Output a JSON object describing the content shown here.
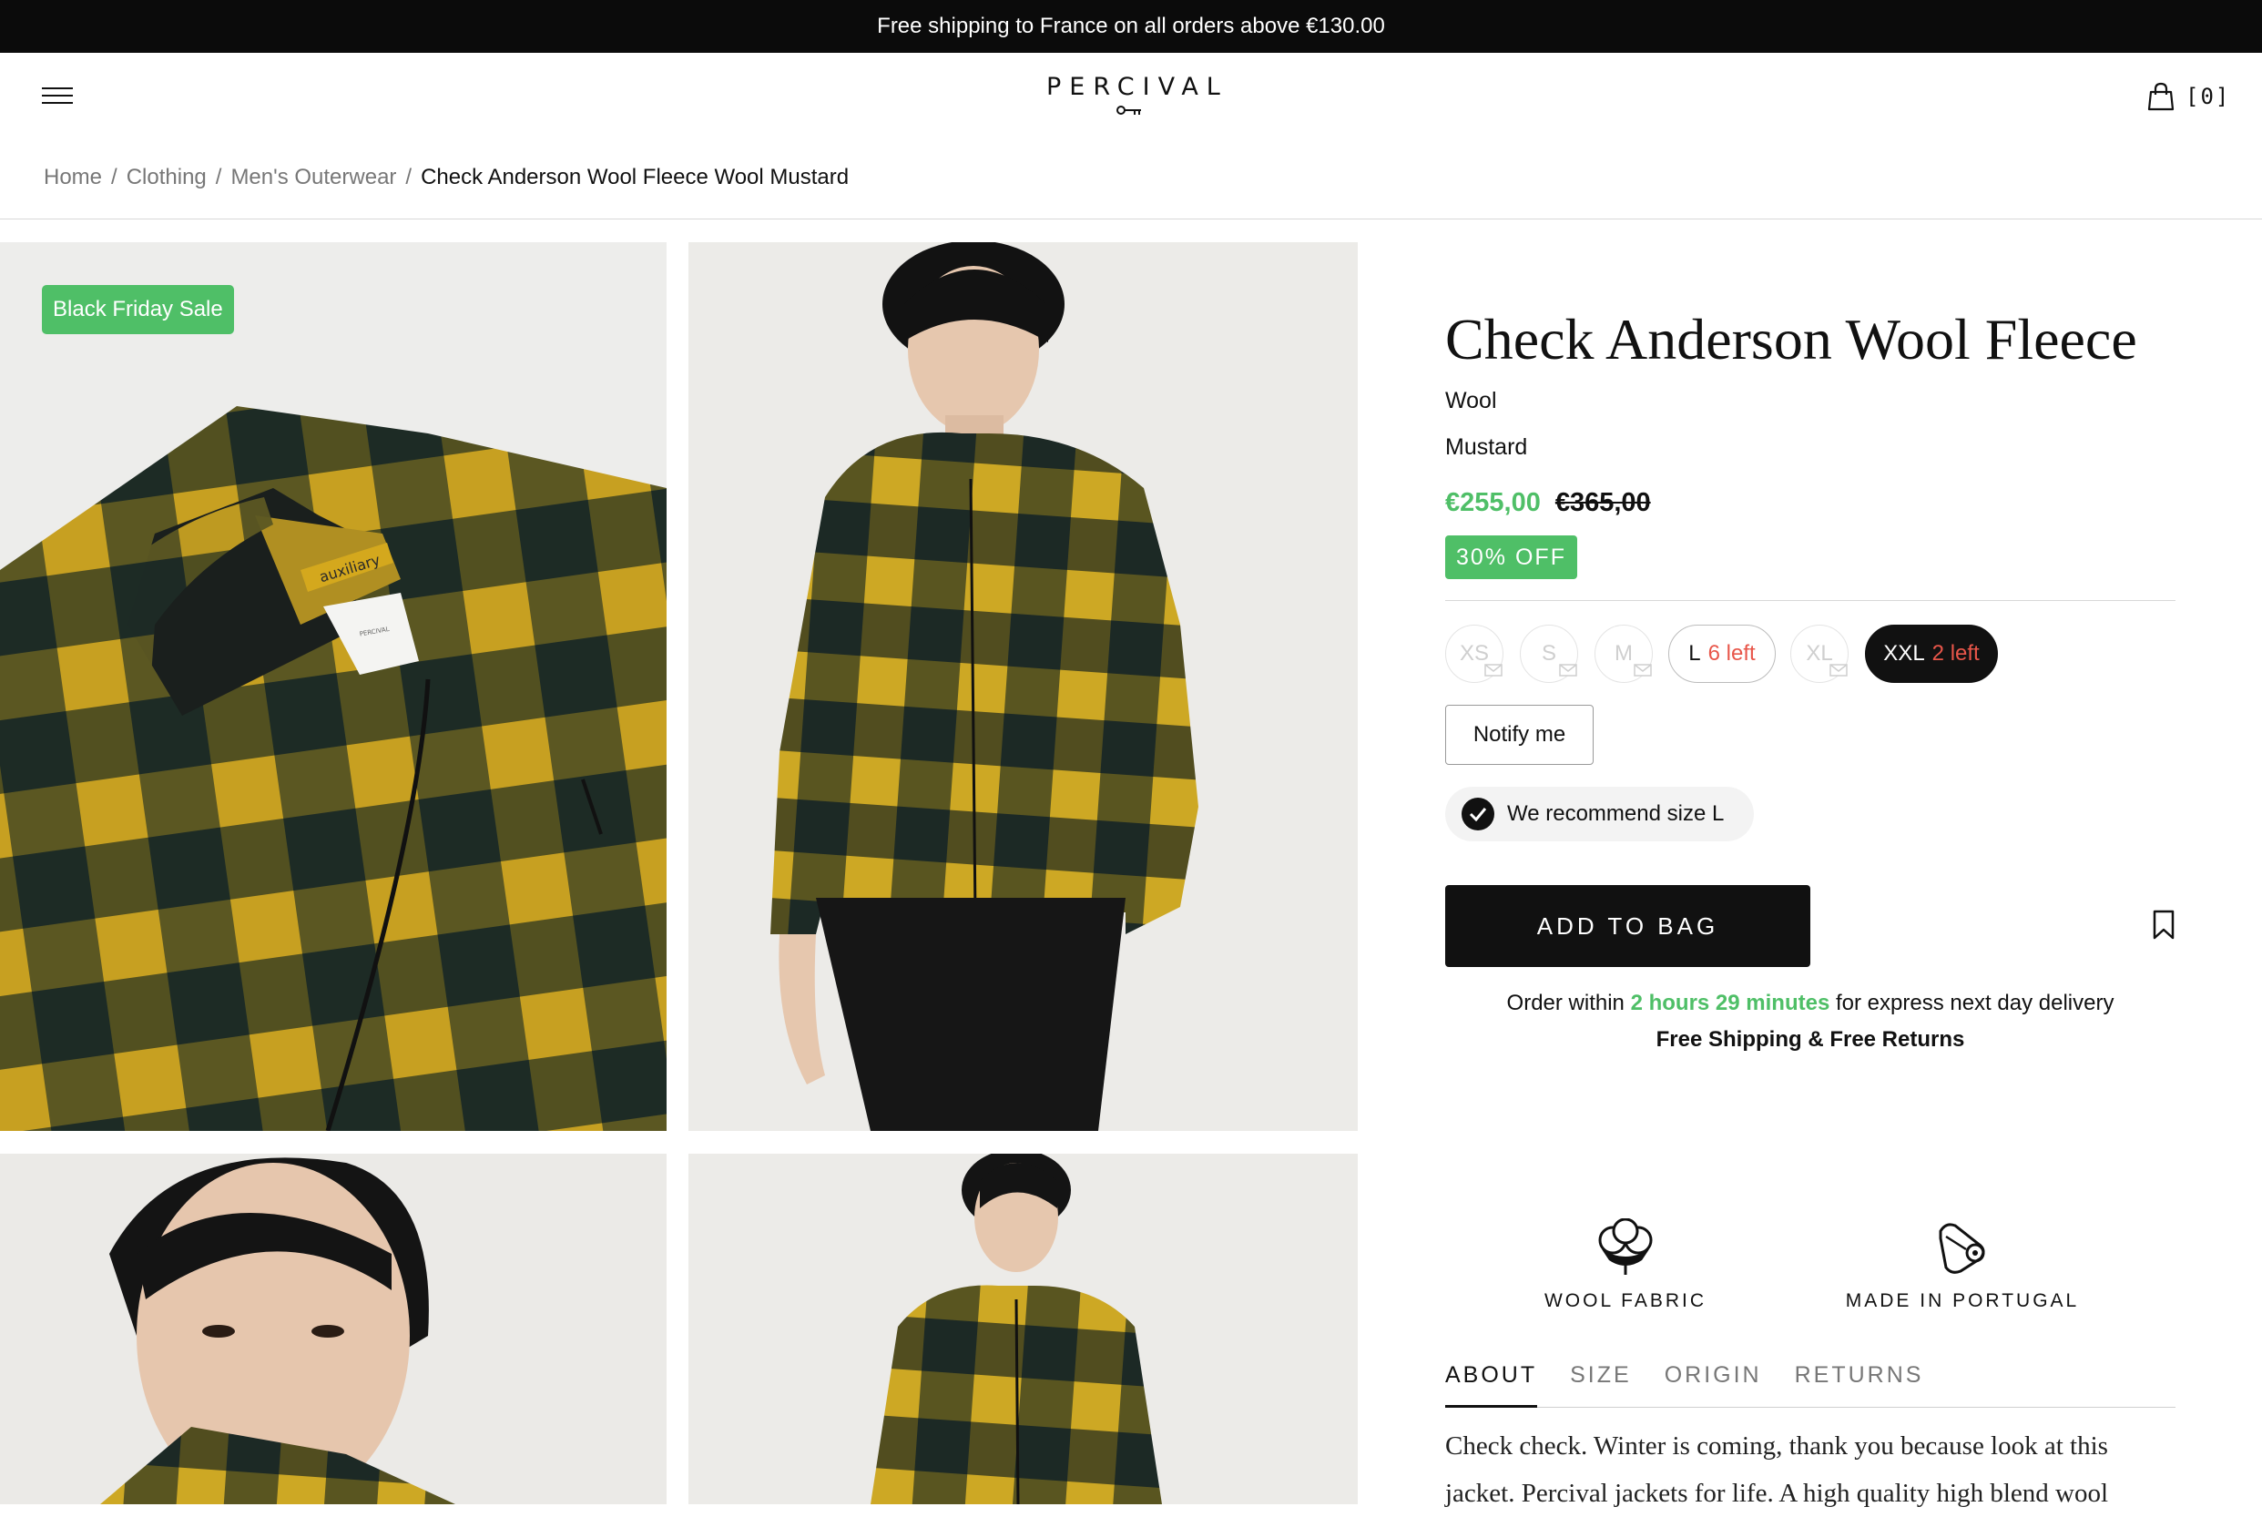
{
  "announcement": "Free shipping to France on all orders above €130.00",
  "header": {
    "logo": "PERCIVAL",
    "bag_count": "[0]"
  },
  "breadcrumb": {
    "items": [
      "Home",
      "Clothing",
      "Men's Outerwear"
    ],
    "separator": "/",
    "current": "Check Anderson Wool Fleece Wool Mustard"
  },
  "gallery": {
    "badge": "Black Friday Sale",
    "label_text": "auxiliary",
    "tag_text": "PERCIVAL"
  },
  "product": {
    "title": "Check Anderson Wool Fleece",
    "material": "Wool",
    "color": "Mustard",
    "price": "€255,00",
    "original_price": "€365,00",
    "discount": "30% OFF"
  },
  "sizes": [
    {
      "label": "XS",
      "stock": "",
      "state": "disabled"
    },
    {
      "label": "S",
      "stock": "",
      "state": "disabled"
    },
    {
      "label": "M",
      "stock": "",
      "state": "disabled"
    },
    {
      "label": "L",
      "stock": "6 left",
      "state": "available"
    },
    {
      "label": "XL",
      "stock": "",
      "state": "disabled"
    },
    {
      "label": "XXL",
      "stock": "2 left",
      "state": "selected"
    }
  ],
  "notify_label": "Notify me",
  "recommend_text": "We recommend size L",
  "add_to_bag": "ADD TO BAG",
  "delivery": {
    "prefix": "Order within",
    "highlight": "2 hours 29 minutes",
    "suffix": "for express next day delivery",
    "free": "Free Shipping & Free Returns"
  },
  "features": [
    {
      "label": "WOOL FABRIC",
      "icon": "cotton-icon"
    },
    {
      "label": "MADE IN PORTUGAL",
      "icon": "fabric-roll-icon"
    }
  ],
  "tabs": [
    {
      "label": "ABOUT",
      "active": true
    },
    {
      "label": "SIZE",
      "active": false
    },
    {
      "label": "ORIGIN",
      "active": false
    },
    {
      "label": "RETURNS",
      "active": false
    }
  ],
  "about_text": "Check check. Winter is coming, thank you because look at this jacket. Percival jackets for life. A high quality high blend wool",
  "colors": {
    "accent_green": "#4fbf67",
    "stock_red": "#e8564a",
    "plaid_mustard": "#c9a41f",
    "plaid_dark": "#1b2a26"
  }
}
